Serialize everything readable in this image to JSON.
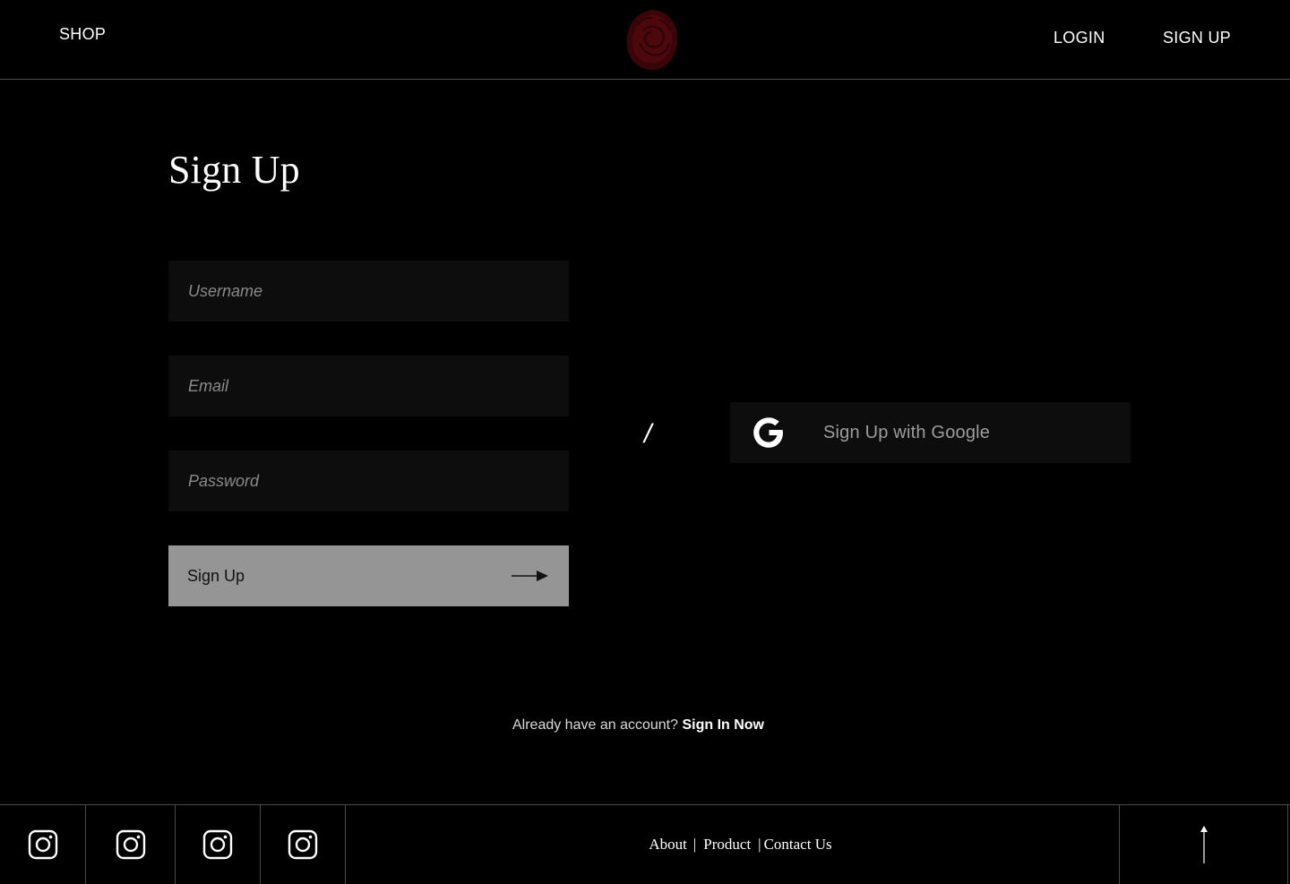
{
  "header": {
    "shop_label": "SHOP",
    "login_label": "LOGIN",
    "signup_label": "SIGN UP",
    "logo_icon": "rose-logo-icon"
  },
  "main": {
    "title": "Sign Up",
    "fields": {
      "username_placeholder": "Username",
      "email_placeholder": "Email",
      "password_placeholder": "Password"
    },
    "submit_label": "Sign Up",
    "divider": "/",
    "google_label": "Sign Up with Google",
    "account_prompt": "Already have an account?",
    "signin_label": "Sign In Now"
  },
  "footer": {
    "links": {
      "about": "About",
      "product": "Product",
      "contact": "Contact Us"
    },
    "separator": "|",
    "social_icons": [
      "instagram-icon",
      "instagram-icon",
      "instagram-icon",
      "instagram-icon"
    ]
  },
  "colors": {
    "background": "#000000",
    "field_background": "#0d0d0d",
    "button_background": "#959595",
    "logo_accent": "#5a0a0f",
    "border": "#4a4a4a"
  }
}
